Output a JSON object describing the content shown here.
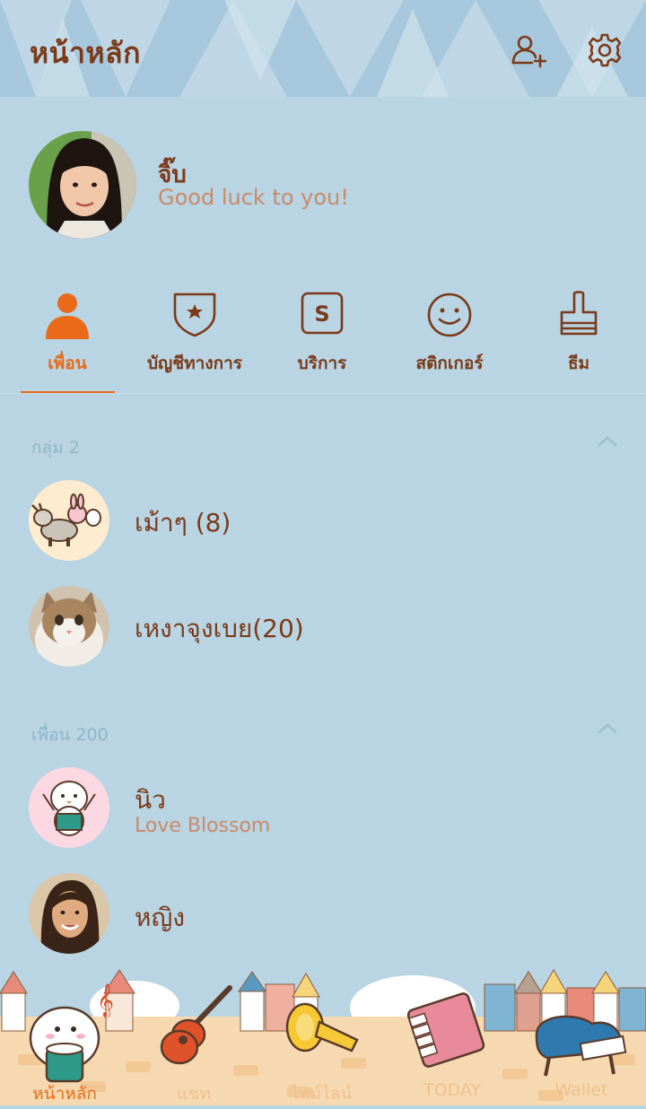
{
  "header": {
    "title": "หน้าหลัก",
    "add_friend_icon": "add-friend-icon",
    "settings_icon": "gear-icon"
  },
  "profile": {
    "name": "จิ๊บ",
    "status": "Good luck to you!"
  },
  "tabs": [
    {
      "label": "เพื่อน",
      "icon": "person-icon",
      "active": true
    },
    {
      "label": "บัญชีทางการ",
      "icon": "shield-star-icon",
      "active": false
    },
    {
      "label": "บริการ",
      "icon": "service-s-icon",
      "active": false
    },
    {
      "label": "สติกเกอร์",
      "icon": "smiley-icon",
      "active": false
    },
    {
      "label": "ธีม",
      "icon": "brush-icon",
      "active": false
    }
  ],
  "groups": {
    "header": "กลุ่ม 2",
    "items": [
      {
        "name": "เม้าๆ (8)"
      },
      {
        "name": "เหงาจุงเบย(20)"
      }
    ]
  },
  "friends": {
    "header": "เพื่อน 200",
    "items": [
      {
        "name": "นิว",
        "status": "Love Blossom"
      },
      {
        "name": "หญิง"
      }
    ]
  },
  "bottom_nav": [
    {
      "label": "หน้าหลัก",
      "active": true
    },
    {
      "label": "แชท",
      "active": false
    },
    {
      "label": "ไทม์ไลน์",
      "active": false
    },
    {
      "label": "TODAY",
      "active": false
    },
    {
      "label": "Wallet",
      "active": false
    }
  ],
  "colors": {
    "background": "#b9d4e2",
    "primary_text": "#7a3a1a",
    "accent": "#ea6a1a",
    "secondary_text": "#c98a6a",
    "section_text": "#8fb5c9"
  }
}
